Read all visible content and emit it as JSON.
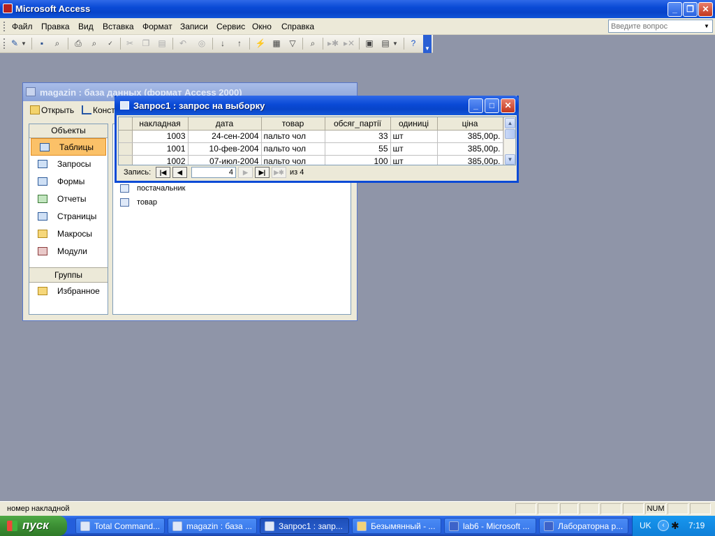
{
  "app": {
    "title": "Microsoft Access"
  },
  "menu": {
    "items": [
      "Файл",
      "Правка",
      "Вид",
      "Вставка",
      "Формат",
      "Записи",
      "Сервис",
      "Окно",
      "Справка"
    ],
    "search_placeholder": "Введите вопрос"
  },
  "db_window": {
    "title": "magazin : база данных (формат Access 2000)",
    "open_label": "Открыть",
    "design_label": "Конст",
    "objects_header": "Объекты",
    "objects": [
      "Таблицы",
      "Запросы",
      "Формы",
      "Отчеты",
      "Страницы",
      "Макросы",
      "Модули"
    ],
    "selected_object": "Таблицы",
    "groups_header": "Группы",
    "groups": [
      "Избранное"
    ],
    "list_items": [
      "постачальник",
      "товар"
    ]
  },
  "query_window": {
    "title": "Запрос1 : запрос на выборку",
    "columns": [
      "накладная",
      "дата",
      "товар",
      "обсяг_партії",
      "одиниці",
      "ціна"
    ],
    "rows": [
      [
        "1003",
        "24-сен-2004",
        "пальто чол",
        "33",
        "шт",
        "385,00р."
      ],
      [
        "1001",
        "10-фев-2004",
        "пальто чол",
        "55",
        "шт",
        "385,00р."
      ],
      [
        "1002",
        "07-июл-2004",
        "пальто чол",
        "100",
        "шт",
        "385,00р."
      ]
    ],
    "record_label": "Запись:",
    "current_record": "4",
    "total_label": "из  4"
  },
  "statusbar": {
    "text": "номер накладной",
    "num": "NUM"
  },
  "taskbar": {
    "start": "пуск",
    "tasks": [
      "Total Command...",
      "magazin : база ...",
      "Запрос1 : запр...",
      "Безымянный - ...",
      "lab6 - Microsoft ...",
      "Лабораторна р..."
    ],
    "active_task": "Запрос1 : запр...",
    "lang": "UK",
    "clock": "7:19"
  }
}
